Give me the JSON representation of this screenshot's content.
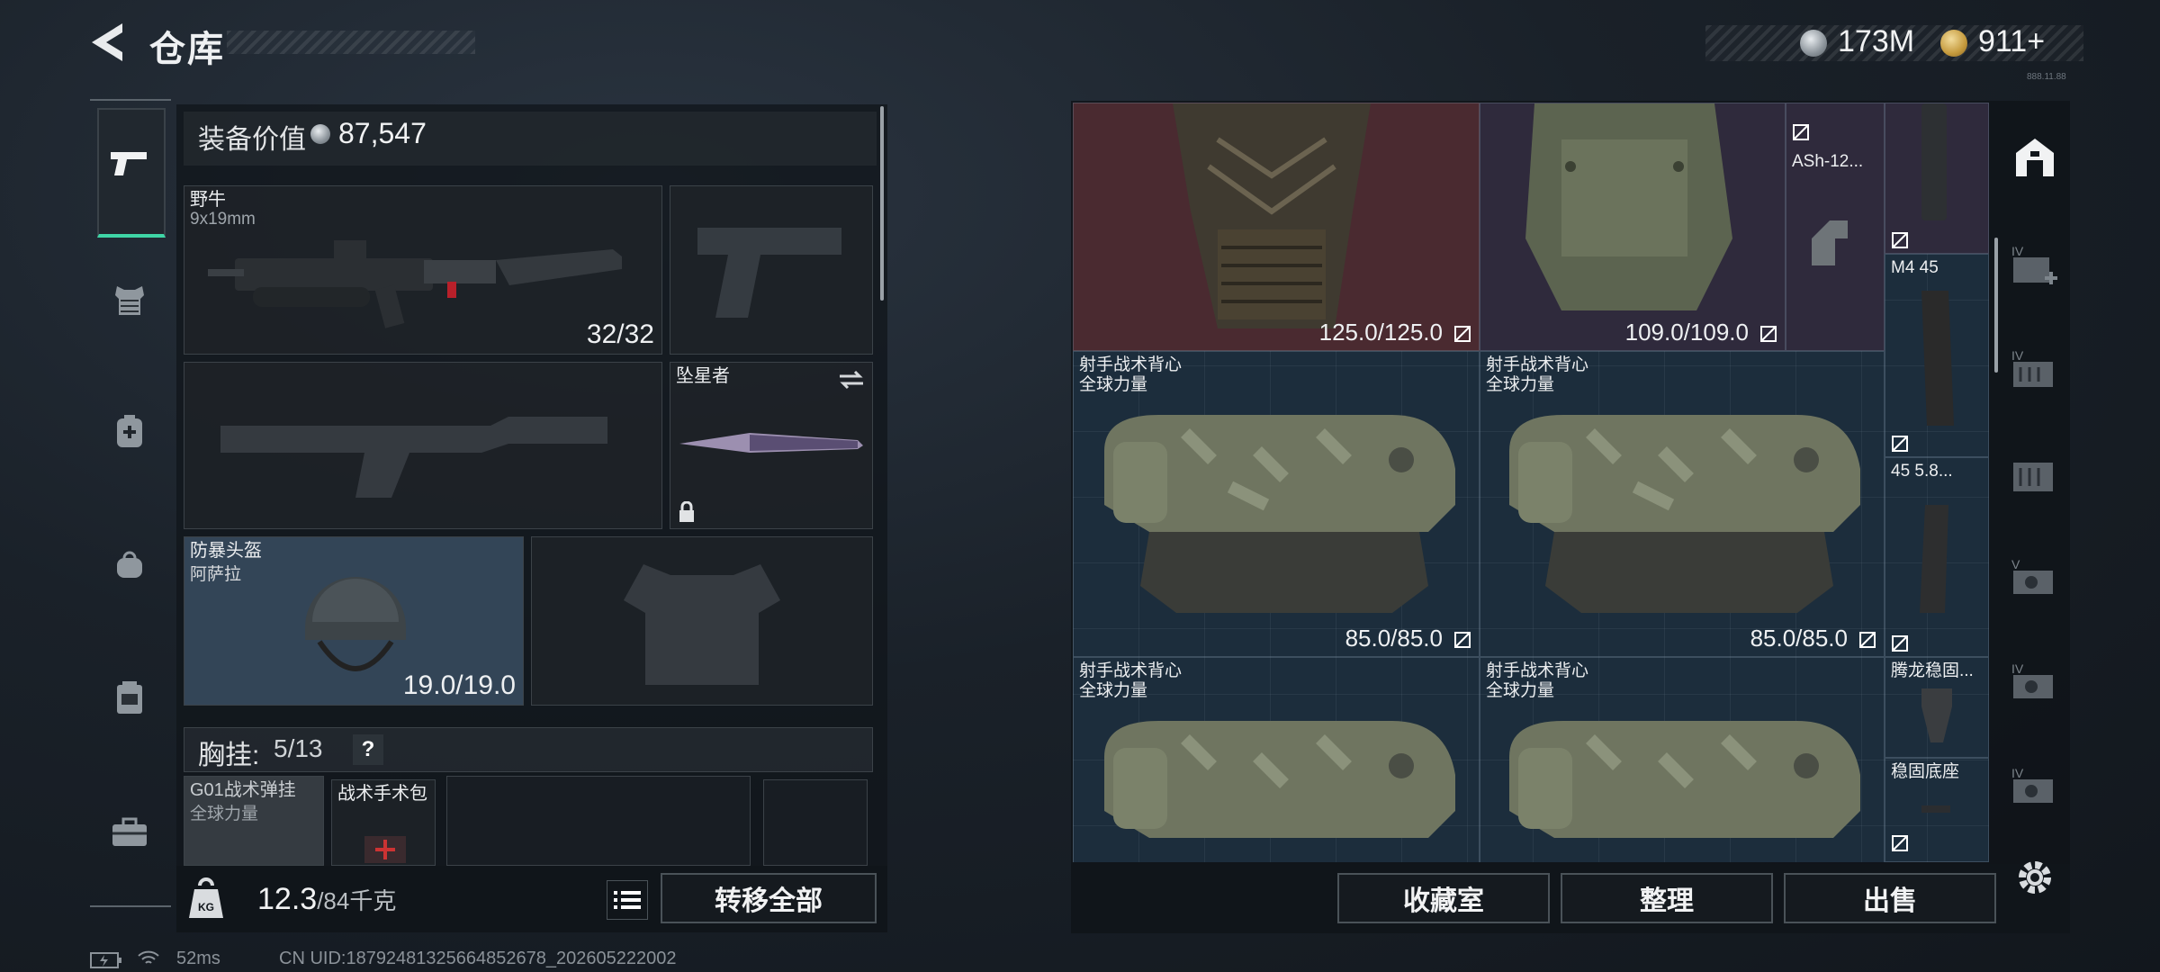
{
  "header": {
    "title": "仓库",
    "currency_silver": "173M",
    "currency_gold": "911+",
    "tiny_label": "888.11.88"
  },
  "left_rail": {
    "items": [
      "pistol-tab",
      "armor-vest-tab",
      "backpack-tab",
      "bag-tab",
      "chest-rig-tab",
      "toolbox-tab"
    ]
  },
  "equipment": {
    "value_label": "装备价值",
    "value": "87,547",
    "primary_weapon": {
      "name": "野牛",
      "caliber": "9x19mm",
      "ammo": "32/32"
    },
    "melee": {
      "name": "坠星者"
    },
    "helmet": {
      "name": "防暴头盔",
      "sub": "阿萨拉",
      "durability": "19.0/19.0"
    },
    "chest_rig_label": "胸挂:",
    "chest_rig_count": "5/13",
    "help": "?",
    "rig_items": [
      {
        "name": "G01战术弹挂",
        "sub": "全球力量"
      },
      {
        "name": "战术手术包"
      }
    ],
    "weight_value": "12.3",
    "weight_unit": "/84千克",
    "transfer_all": "转移全部"
  },
  "stash": {
    "top_left_armor": {
      "durability": "125.0/125.0"
    },
    "top_mid_armor": {
      "durability": "109.0/109.0"
    },
    "small_items": [
      {
        "name": "ASh-12..."
      },
      {
        "name": "M4 45"
      },
      {
        "name": "45 5.8..."
      },
      {
        "name": "腾龙稳固..."
      },
      {
        "name": "稳固底座"
      }
    ],
    "vests": [
      {
        "name": "射手战术背心",
        "sub": "全球力量",
        "durability": "85.0/85.0"
      },
      {
        "name": "射手战术背心",
        "sub": "全球力量",
        "durability": "85.0/85.0"
      },
      {
        "name": "射手战术背心",
        "sub": "全球力量",
        "durability": ""
      },
      {
        "name": "射手战术背心",
        "sub": "全球力量",
        "durability": ""
      }
    ],
    "buttons": {
      "collection": "收藏室",
      "sort": "整理",
      "sell": "出售"
    }
  },
  "right_rail": {
    "icons": [
      "vault-icon",
      "add-stash-icon",
      "stash-page-2-icon",
      "stash-page-3-icon",
      "stash-page-4-icon",
      "stash-page-5-icon",
      "stash-page-6-icon"
    ],
    "labels": [
      "",
      "IV",
      "IV",
      "",
      "V",
      "IV",
      "IV"
    ]
  },
  "status_bar": {
    "ping": "52ms",
    "uid": "CN UID:18792481325664852678_202605222002"
  }
}
